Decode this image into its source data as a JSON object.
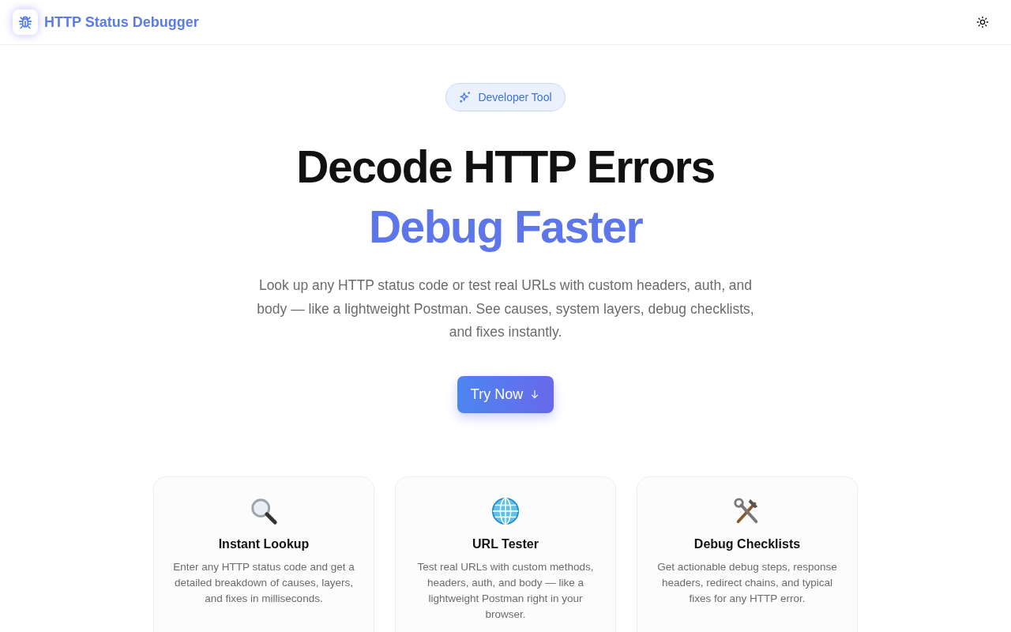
{
  "header": {
    "app_name": "HTTP Status Debugger"
  },
  "hero": {
    "badge": "Developer Tool",
    "title": "Decode HTTP Errors",
    "subtitle": "Debug Faster",
    "description": "Look up any HTTP status code or test real URLs with custom headers, auth, and body — like a lightweight Postman. See causes, system layers, debug checklists, and fixes instantly.",
    "button": "Try Now"
  },
  "features": [
    {
      "title": "Instant Lookup",
      "text": "Enter any HTTP status code and get a detailed breakdown of causes, layers, and fixes in milliseconds."
    },
    {
      "title": "URL Tester",
      "text": "Test real URLs with custom methods, headers, auth, and body — like a lightweight Postman right in your browser."
    },
    {
      "title": "Debug Checklists",
      "text": "Get actionable debug steps, response headers, redirect chains, and typical fixes for any HTTP error."
    }
  ]
}
